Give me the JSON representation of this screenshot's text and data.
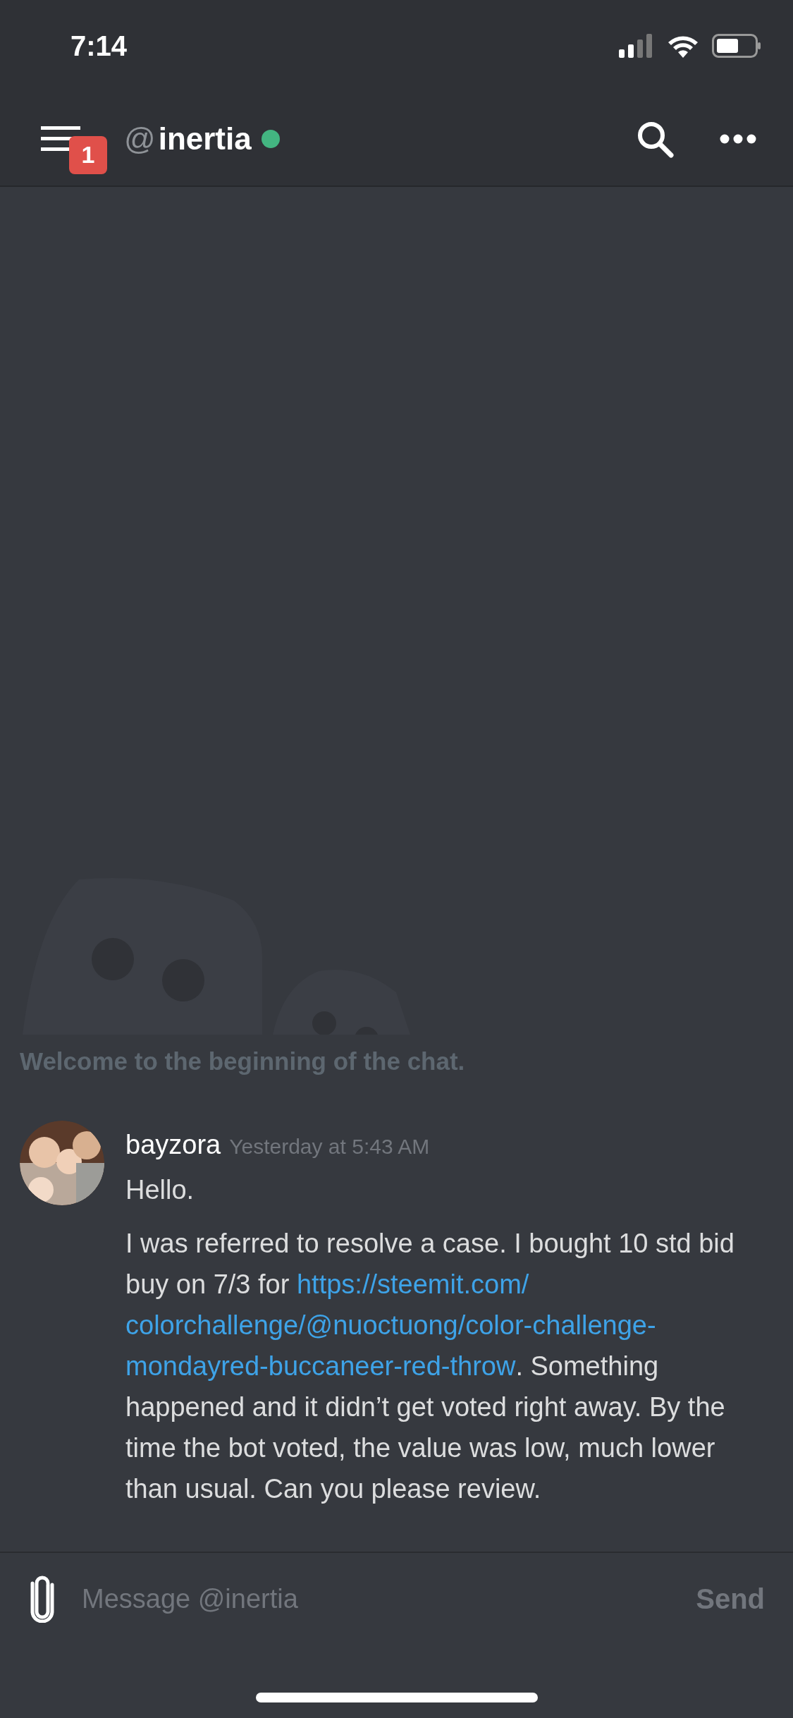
{
  "status_bar": {
    "time": "7:14"
  },
  "header": {
    "badge": "1",
    "prefix": "@",
    "title": "inertia",
    "online": true
  },
  "chat": {
    "welcome": "Welcome to the beginning of the chat.",
    "messages": [
      {
        "author": "bayzora",
        "timestamp": "Yesterday at 5:43 AM",
        "paragraphs": [
          {
            "parts": [
              {
                "kind": "text",
                "text": "Hello."
              }
            ]
          },
          {
            "parts": [
              {
                "kind": "text",
                "text": "I was referred to resolve a case. I bought 10 std bid buy on 7/3 for "
              },
              {
                "kind": "link",
                "text": "https://steemit.com/"
              },
              {
                "kind": "link",
                "text": "colorchallenge/@nuoctuong/color-challenge-"
              },
              {
                "kind": "link",
                "text": "mondayred-buccaneer-red-throw"
              },
              {
                "kind": "text",
                "text": ". Something happened and it didn’t get voted right away. By the time the bot voted, the value was low, much lower than usual. Can you please review."
              }
            ]
          }
        ]
      }
    ]
  },
  "composer": {
    "placeholder": "Message @inertia",
    "send": "Send"
  }
}
